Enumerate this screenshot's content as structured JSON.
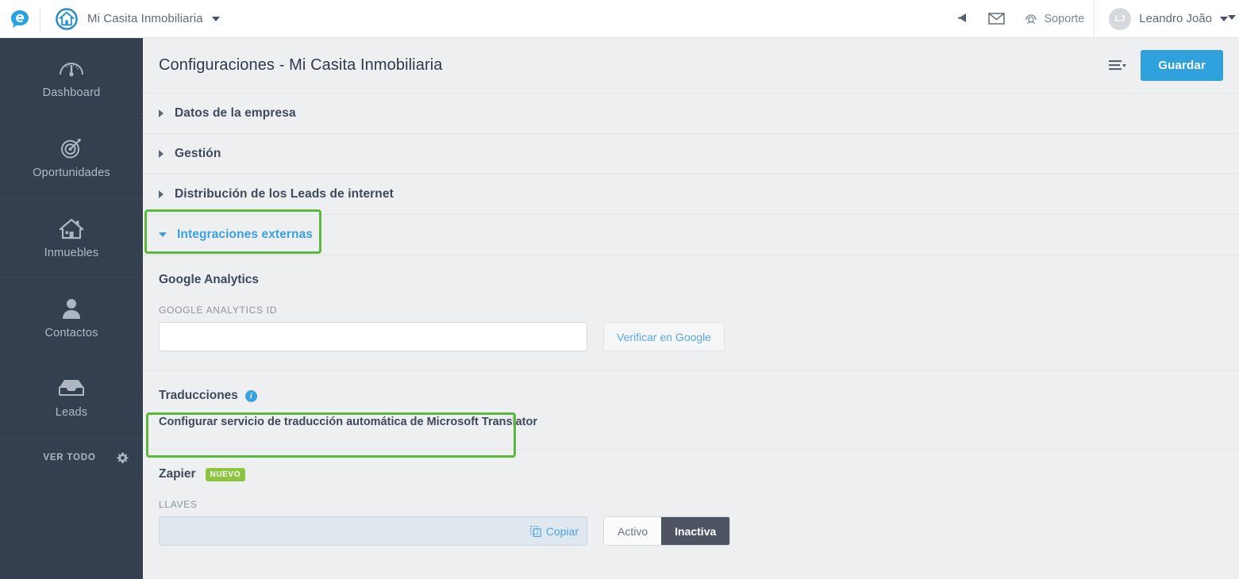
{
  "topbar": {
    "app_logo_icon": "speech-bubble-e-logo",
    "company_logo_icon": "house-in-circle-logo",
    "company_name": "Mi Casita Inmobiliaria",
    "company_caret_icon": "caret-down-icon",
    "notifications_icon": "bell-icon",
    "messages_icon": "envelope-icon",
    "support_icon": "headset-icon",
    "support_label": "Soporte",
    "avatar_initials": "LJ",
    "user_name": "Leandro João",
    "user_caret_icon": "caret-down-icon"
  },
  "sidebar": {
    "items": [
      {
        "label": "Dashboard",
        "icon": "gauge-icon"
      },
      {
        "label": "Oportunidades",
        "icon": "target-icon"
      },
      {
        "label": "Inmuebles",
        "icon": "house-icon"
      },
      {
        "label": "Contactos",
        "icon": "person-icon"
      },
      {
        "label": "Leads",
        "icon": "inbox-tray-icon"
      }
    ],
    "footer_label": "VER TODO",
    "footer_icon": "gear-icon"
  },
  "page": {
    "title": "Configuraciones - Mi Casita Inmobiliaria",
    "menu_icon": "list-menu-icon",
    "save_label": "Guardar"
  },
  "accordion": [
    {
      "label": "Datos de la empresa",
      "expanded": false
    },
    {
      "label": "Gestión",
      "expanded": false
    },
    {
      "label": "Distribución de los Leads de internet",
      "expanded": false
    },
    {
      "label": "Integraciones externas",
      "expanded": true
    }
  ],
  "google_analytics": {
    "title": "Google Analytics",
    "field_label": "GOOGLE ANALYTICS ID",
    "field_value": "",
    "field_placeholder": "",
    "verify_label": "Verificar en Google"
  },
  "traducciones": {
    "title": "Traducciones",
    "info_icon": "info-icon",
    "info_glyph": "i",
    "link_label": "Configurar servicio de traducción automática de Microsoft Translator"
  },
  "zapier": {
    "title": "Zapier",
    "badge": "NUEVO",
    "field_label": "LLAVES",
    "field_value": "",
    "copy_icon": "copy-icon",
    "copy_label": "Copiar",
    "toggle_options": [
      "Activo",
      "Inactiva"
    ],
    "toggle_selected": "Inactiva"
  },
  "colors": {
    "accent_blue": "#2fa2dd",
    "link_blue": "#3aa0e0",
    "sidebar_dark": "#343f4f",
    "page_bg": "#eeeff1",
    "highlight_green": "#5cb83c",
    "badge_green": "#8cc63e",
    "toggle_active_dark": "#4d5565"
  }
}
